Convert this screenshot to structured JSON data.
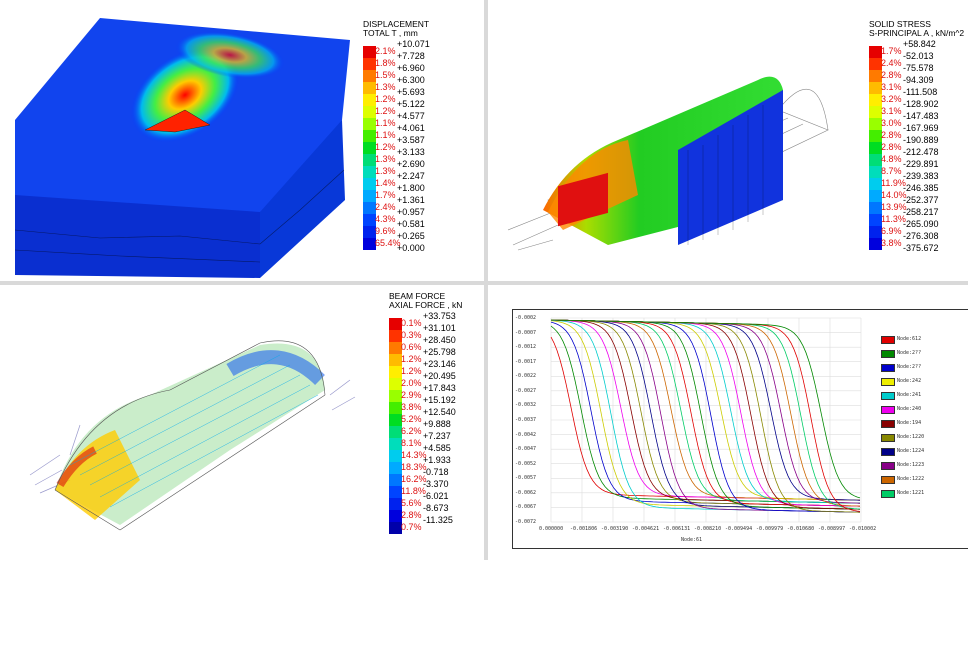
{
  "panel1": {
    "legend_title_1": "DISPLACEMENT",
    "legend_title_2": "TOTAL T , mm",
    "rows": [
      {
        "pct": "2.1%",
        "val": "+10.071",
        "color": "#e60000"
      },
      {
        "pct": "1.8%",
        "val": "+7.728",
        "color": "#ff3300"
      },
      {
        "pct": "1.5%",
        "val": "+6.960",
        "color": "#ff7a00"
      },
      {
        "pct": "1.3%",
        "val": "+6.300",
        "color": "#ffbb00"
      },
      {
        "pct": "1.2%",
        "val": "+5.693",
        "color": "#ffee00"
      },
      {
        "pct": "1.2%",
        "val": "+5.122",
        "color": "#ddff00"
      },
      {
        "pct": "1.1%",
        "val": "+4.577",
        "color": "#99ff00"
      },
      {
        "pct": "1.1%",
        "val": "+4.061",
        "color": "#44ee00"
      },
      {
        "pct": "1.2%",
        "val": "+3.587",
        "color": "#00dd22"
      },
      {
        "pct": "1.3%",
        "val": "+3.133",
        "color": "#00dd77"
      },
      {
        "pct": "1.3%",
        "val": "+2.690",
        "color": "#00ddbb"
      },
      {
        "pct": "1.4%",
        "val": "+2.247",
        "color": "#00ccee"
      },
      {
        "pct": "1.7%",
        "val": "+1.800",
        "color": "#00aaff"
      },
      {
        "pct": "2.4%",
        "val": "+1.361",
        "color": "#0077ff"
      },
      {
        "pct": "4.3%",
        "val": "+0.957",
        "color": "#0044ff"
      },
      {
        "pct": "9.6%",
        "val": "+0.581",
        "color": "#0022ee"
      },
      {
        "pct": "65.4%",
        "val": "+0.265",
        "color": "#0000dd"
      }
    ],
    "last_val": "+0.000"
  },
  "panel2": {
    "legend_title_1": "SOLID STRESS",
    "legend_title_2": "S-PRINCIPAL A , kN/m^2",
    "rows": [
      {
        "pct": "1.7%",
        "val": "+58.842",
        "color": "#e60000"
      },
      {
        "pct": "2.4%",
        "val": "-52.013",
        "color": "#ff3300"
      },
      {
        "pct": "2.8%",
        "val": "-75.578",
        "color": "#ff7a00"
      },
      {
        "pct": "3.1%",
        "val": "-94.309",
        "color": "#ffbb00"
      },
      {
        "pct": "3.2%",
        "val": "-111.508",
        "color": "#ffee00"
      },
      {
        "pct": "3.1%",
        "val": "-128.902",
        "color": "#ddff00"
      },
      {
        "pct": "3.0%",
        "val": "-147.483",
        "color": "#99ff00"
      },
      {
        "pct": "2.8%",
        "val": "-167.969",
        "color": "#44ee00"
      },
      {
        "pct": "2.8%",
        "val": "-190.889",
        "color": "#00dd22"
      },
      {
        "pct": "4.8%",
        "val": "-212.478",
        "color": "#00dd77"
      },
      {
        "pct": "8.7%",
        "val": "-229.891",
        "color": "#00ddbb"
      },
      {
        "pct": "11.9%",
        "val": "-239.383",
        "color": "#00ccee"
      },
      {
        "pct": "14.0%",
        "val": "-246.385",
        "color": "#00aaff"
      },
      {
        "pct": "13.9%",
        "val": "-252.377",
        "color": "#0077ff"
      },
      {
        "pct": "11.3%",
        "val": "-258.217",
        "color": "#0044ff"
      },
      {
        "pct": "6.9%",
        "val": "-265.090",
        "color": "#0022ee"
      },
      {
        "pct": "3.8%",
        "val": "-276.308",
        "color": "#0000dd"
      }
    ],
    "last_val": "-375.672"
  },
  "panel3": {
    "legend_title_1": "BEAM FORCE",
    "legend_title_2": "AXIAL FORCE , kN",
    "rows": [
      {
        "pct": "0.1%",
        "val": "+33.753",
        "color": "#e60000"
      },
      {
        "pct": "0.3%",
        "val": "+31.101",
        "color": "#ff3300"
      },
      {
        "pct": "0.6%",
        "val": "+28.450",
        "color": "#ff7a00"
      },
      {
        "pct": "1.2%",
        "val": "+25.798",
        "color": "#ffbb00"
      },
      {
        "pct": "1.2%",
        "val": "+23.146",
        "color": "#ffee00"
      },
      {
        "pct": "2.0%",
        "val": "+20.495",
        "color": "#ddff00"
      },
      {
        "pct": "2.9%",
        "val": "+17.843",
        "color": "#99ff00"
      },
      {
        "pct": "3.8%",
        "val": "+15.192",
        "color": "#44ee00"
      },
      {
        "pct": "5.2%",
        "val": "+12.540",
        "color": "#00dd22"
      },
      {
        "pct": "6.2%",
        "val": "+9.888",
        "color": "#00dd77"
      },
      {
        "pct": "8.1%",
        "val": "+7.237",
        "color": "#00ddbb"
      },
      {
        "pct": "14.3%",
        "val": "+4.585",
        "color": "#00ccee"
      },
      {
        "pct": "18.3%",
        "val": "+1.933",
        "color": "#00aaff"
      },
      {
        "pct": "16.2%",
        "val": "-0.718",
        "color": "#0077ff"
      },
      {
        "pct": "11.8%",
        "val": "-3.370",
        "color": "#0044ff"
      },
      {
        "pct": "5.6%",
        "val": "-6.021",
        "color": "#0022ee"
      },
      {
        "pct": "2.8%",
        "val": "-8.673",
        "color": "#0000dd"
      },
      {
        "pct": "0.7%",
        "val": "-11.325",
        "color": "#0000aa"
      }
    ]
  },
  "panel4": {
    "y_ticks": [
      "-0.0002",
      "-0.0007",
      "-0.0012",
      "-0.0017",
      "-0.0022",
      "-0.0027",
      "-0.0032",
      "-0.0037",
      "-0.0042",
      "-0.0047",
      "-0.0052",
      "-0.0057",
      "-0.0062",
      "-0.0067",
      "-0.0072"
    ],
    "x_ticks": [
      "0.000000",
      "-0.001806",
      "-0.003190",
      "-0.004621",
      "-0.006131",
      "-0.008210",
      "-0.009494",
      "-0.009979",
      "-0.010680",
      "-0.008997",
      "-0.010002"
    ],
    "x_label": "Node:61",
    "legend": [
      {
        "name": "Node:612",
        "color": "#e00000"
      },
      {
        "name": "Node:2??",
        "color": "#008800"
      },
      {
        "name": "Node:2??",
        "color": "#0000cc"
      },
      {
        "name": "Node:242",
        "color": "#eeee00"
      },
      {
        "name": "Node:241",
        "color": "#00cccc"
      },
      {
        "name": "Node:240",
        "color": "#ee00ee"
      },
      {
        "name": "Node:194",
        "color": "#880000"
      },
      {
        "name": "Node:1220",
        "color": "#888800"
      },
      {
        "name": "Node:1224",
        "color": "#000088"
      },
      {
        "name": "Node:1223",
        "color": "#880088"
      },
      {
        "name": "Node:1222",
        "color": "#cc6600"
      },
      {
        "name": "Node:1221",
        "color": "#00cc66"
      }
    ]
  },
  "colors": {
    "separator": "#d9d9d9",
    "background": "#ffffff"
  }
}
